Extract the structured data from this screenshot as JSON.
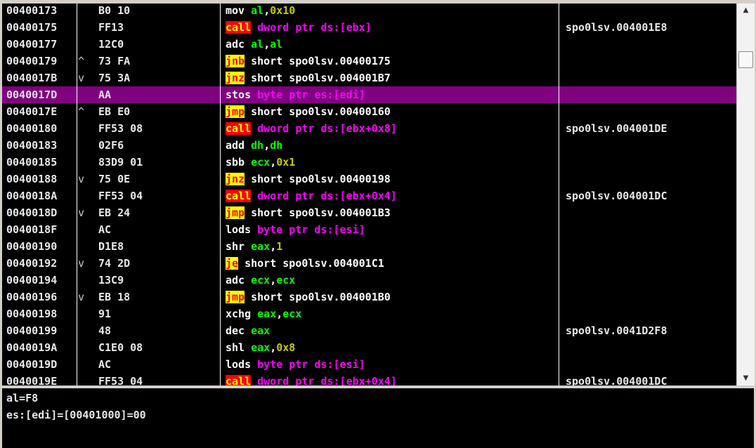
{
  "disassembly": {
    "rows": [
      {
        "address": "00400173",
        "marker": "",
        "hex": "B0 10",
        "selected": false,
        "tokens": [
          {
            "t": "mov",
            "c": "plain"
          },
          {
            "t": " "
          },
          {
            "t": "al",
            "c": "reg"
          },
          {
            "t": ","
          },
          {
            "t": "0x10",
            "c": "num"
          }
        ],
        "comment": ""
      },
      {
        "address": "00400175",
        "marker": "",
        "hex": "FF13",
        "selected": false,
        "tokens": [
          {
            "t": "call",
            "c": "mcall"
          },
          {
            "t": " "
          },
          {
            "t": "dword ptr ds:[ebx]",
            "c": "mem"
          }
        ],
        "comment": "spo0lsv.004001E8"
      },
      {
        "address": "00400177",
        "marker": "",
        "hex": "12C0",
        "selected": false,
        "tokens": [
          {
            "t": "adc",
            "c": "plain"
          },
          {
            "t": " "
          },
          {
            "t": "al",
            "c": "reg"
          },
          {
            "t": ","
          },
          {
            "t": "al",
            "c": "reg"
          }
        ],
        "comment": ""
      },
      {
        "address": "00400179",
        "marker": "^",
        "hex": "73 FA",
        "selected": false,
        "tokens": [
          {
            "t": "jnb",
            "c": "mjmp"
          },
          {
            "t": " short spo0lsv.00400175",
            "c": "plain"
          }
        ],
        "comment": ""
      },
      {
        "address": "0040017B",
        "marker": "v",
        "hex": "75 3A",
        "selected": false,
        "tokens": [
          {
            "t": "jnz",
            "c": "mjmp"
          },
          {
            "t": " short spo0lsv.004001B7",
            "c": "plain"
          }
        ],
        "comment": ""
      },
      {
        "address": "0040017D",
        "marker": "",
        "hex": "AA",
        "selected": true,
        "tokens": [
          {
            "t": "stos",
            "c": "plain"
          },
          {
            "t": " "
          },
          {
            "t": "byte ptr es:[edi]",
            "c": "mem"
          }
        ],
        "comment": ""
      },
      {
        "address": "0040017E",
        "marker": "^",
        "hex": "EB E0",
        "selected": false,
        "tokens": [
          {
            "t": "jmp",
            "c": "mjmp"
          },
          {
            "t": " short spo0lsv.00400160",
            "c": "plain"
          }
        ],
        "comment": ""
      },
      {
        "address": "00400180",
        "marker": "",
        "hex": "FF53 08",
        "selected": false,
        "tokens": [
          {
            "t": "call",
            "c": "mcall"
          },
          {
            "t": " "
          },
          {
            "t": "dword ptr ds:[ebx+0x8]",
            "c": "mem"
          }
        ],
        "comment": "spo0lsv.004001DE"
      },
      {
        "address": "00400183",
        "marker": "",
        "hex": "02F6",
        "selected": false,
        "tokens": [
          {
            "t": "add",
            "c": "plain"
          },
          {
            "t": " "
          },
          {
            "t": "dh",
            "c": "reg"
          },
          {
            "t": ","
          },
          {
            "t": "dh",
            "c": "reg"
          }
        ],
        "comment": ""
      },
      {
        "address": "00400185",
        "marker": "",
        "hex": "83D9 01",
        "selected": false,
        "tokens": [
          {
            "t": "sbb",
            "c": "plain"
          },
          {
            "t": " "
          },
          {
            "t": "ecx",
            "c": "reg"
          },
          {
            "t": ","
          },
          {
            "t": "0x1",
            "c": "num"
          }
        ],
        "comment": ""
      },
      {
        "address": "00400188",
        "marker": "v",
        "hex": "75 0E",
        "selected": false,
        "tokens": [
          {
            "t": "jnz",
            "c": "mjmp"
          },
          {
            "t": " short spo0lsv.00400198",
            "c": "plain"
          }
        ],
        "comment": ""
      },
      {
        "address": "0040018A",
        "marker": "",
        "hex": "FF53 04",
        "selected": false,
        "tokens": [
          {
            "t": "call",
            "c": "mcall"
          },
          {
            "t": " "
          },
          {
            "t": "dword ptr ds:[ebx+0x4]",
            "c": "mem"
          }
        ],
        "comment": "spo0lsv.004001DC"
      },
      {
        "address": "0040018D",
        "marker": "v",
        "hex": "EB 24",
        "selected": false,
        "tokens": [
          {
            "t": "jmp",
            "c": "mjmp"
          },
          {
            "t": " short spo0lsv.004001B3",
            "c": "plain"
          }
        ],
        "comment": ""
      },
      {
        "address": "0040018F",
        "marker": "",
        "hex": "AC",
        "selected": false,
        "tokens": [
          {
            "t": "lods",
            "c": "plain"
          },
          {
            "t": " "
          },
          {
            "t": "byte ptr ds:[esi]",
            "c": "mem"
          }
        ],
        "comment": ""
      },
      {
        "address": "00400190",
        "marker": "",
        "hex": "D1E8",
        "selected": false,
        "tokens": [
          {
            "t": "shr",
            "c": "plain"
          },
          {
            "t": " "
          },
          {
            "t": "eax",
            "c": "reg"
          },
          {
            "t": ","
          },
          {
            "t": "1",
            "c": "num"
          }
        ],
        "comment": ""
      },
      {
        "address": "00400192",
        "marker": "v",
        "hex": "74 2D",
        "selected": false,
        "tokens": [
          {
            "t": "je",
            "c": "mjmp"
          },
          {
            "t": " short spo0lsv.004001C1",
            "c": "plain"
          }
        ],
        "comment": ""
      },
      {
        "address": "00400194",
        "marker": "",
        "hex": "13C9",
        "selected": false,
        "tokens": [
          {
            "t": "adc",
            "c": "plain"
          },
          {
            "t": " "
          },
          {
            "t": "ecx",
            "c": "reg"
          },
          {
            "t": ","
          },
          {
            "t": "ecx",
            "c": "reg"
          }
        ],
        "comment": ""
      },
      {
        "address": "00400196",
        "marker": "v",
        "hex": "EB 18",
        "selected": false,
        "tokens": [
          {
            "t": "jmp",
            "c": "mjmp"
          },
          {
            "t": " short spo0lsv.004001B0",
            "c": "plain"
          }
        ],
        "comment": ""
      },
      {
        "address": "00400198",
        "marker": "",
        "hex": "91",
        "selected": false,
        "tokens": [
          {
            "t": "xchg",
            "c": "plain"
          },
          {
            "t": " "
          },
          {
            "t": "eax",
            "c": "reg"
          },
          {
            "t": ","
          },
          {
            "t": "ecx",
            "c": "reg"
          }
        ],
        "comment": ""
      },
      {
        "address": "00400199",
        "marker": "",
        "hex": "48",
        "selected": false,
        "tokens": [
          {
            "t": "dec",
            "c": "plain"
          },
          {
            "t": " "
          },
          {
            "t": "eax",
            "c": "reg"
          }
        ],
        "comment": "spo0lsv.0041D2F8"
      },
      {
        "address": "0040019A",
        "marker": "",
        "hex": "C1E0 08",
        "selected": false,
        "tokens": [
          {
            "t": "shl",
            "c": "plain"
          },
          {
            "t": " "
          },
          {
            "t": "eax",
            "c": "reg"
          },
          {
            "t": ","
          },
          {
            "t": "0x8",
            "c": "num"
          }
        ],
        "comment": ""
      },
      {
        "address": "0040019D",
        "marker": "",
        "hex": "AC",
        "selected": false,
        "tokens": [
          {
            "t": "lods",
            "c": "plain"
          },
          {
            "t": " "
          },
          {
            "t": "byte ptr ds:[esi]",
            "c": "mem"
          }
        ],
        "comment": ""
      },
      {
        "address": "0040019E",
        "marker": "",
        "hex": "FF53 04",
        "selected": false,
        "tokens": [
          {
            "t": "call",
            "c": "mcall"
          },
          {
            "t": " "
          },
          {
            "t": "dword ptr ds:[ebx+0x4]",
            "c": "mem"
          }
        ],
        "comment": "spo0lsv.004001DC"
      }
    ]
  },
  "info_pane": {
    "lines": [
      "al=F8",
      "es:[edi]=[00401000]=00"
    ]
  },
  "scrollbar": {
    "up_arrow_icon": "triangle-up-icon",
    "down_arrow_icon": "triangle-down-icon"
  },
  "colors": {
    "background": "#000000",
    "selection": "#800080",
    "register": "#00ff00",
    "memory_operand": "#ff00ff",
    "immediate": "#c8c800",
    "call_mnemonic_bg": "#ff0000",
    "call_mnemonic_fg": "#ffff00",
    "jump_mnemonic_bg": "#ffff00",
    "jump_mnemonic_fg": "#ff0000"
  }
}
